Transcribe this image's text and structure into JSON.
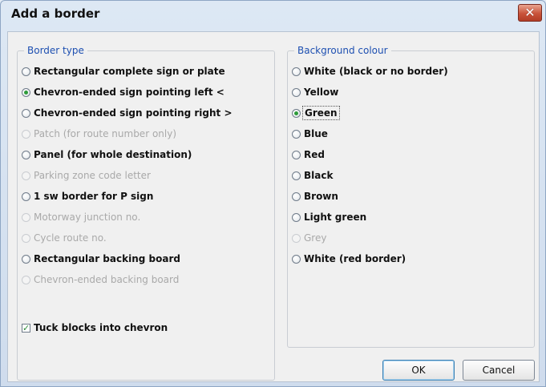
{
  "dialog": {
    "title": "Add a border",
    "close_glyph": "✕"
  },
  "border_type": {
    "legend": "Border type",
    "options": [
      {
        "label": "Rectangular complete sign or plate",
        "checked": false,
        "disabled": false
      },
      {
        "label": "Chevron-ended sign pointing left <",
        "checked": true,
        "disabled": false
      },
      {
        "label": "Chevron-ended sign pointing right >",
        "checked": false,
        "disabled": false
      },
      {
        "label": "Patch (for route number only)",
        "checked": false,
        "disabled": true
      },
      {
        "label": "Panel (for whole destination)",
        "checked": false,
        "disabled": false
      },
      {
        "label": "Parking zone code letter",
        "checked": false,
        "disabled": true
      },
      {
        "label": "1 sw border for P sign",
        "checked": false,
        "disabled": false
      },
      {
        "label": "Motorway junction no.",
        "checked": false,
        "disabled": true
      },
      {
        "label": "Cycle route no.",
        "checked": false,
        "disabled": true
      },
      {
        "label": "Rectangular backing board",
        "checked": false,
        "disabled": false
      },
      {
        "label": "Chevron-ended backing board",
        "checked": false,
        "disabled": true
      }
    ],
    "tuck_label": "Tuck blocks into chevron",
    "tuck_checked": true
  },
  "background_colour": {
    "legend": "Background colour",
    "options": [
      {
        "label": "White (black or no border)",
        "checked": false,
        "disabled": false
      },
      {
        "label": "Yellow",
        "checked": false,
        "disabled": false
      },
      {
        "label": "Green",
        "checked": true,
        "disabled": false
      },
      {
        "label": "Blue",
        "checked": false,
        "disabled": false
      },
      {
        "label": "Red",
        "checked": false,
        "disabled": false
      },
      {
        "label": "Black",
        "checked": false,
        "disabled": false
      },
      {
        "label": "Brown",
        "checked": false,
        "disabled": false
      },
      {
        "label": "Light green",
        "checked": false,
        "disabled": false
      },
      {
        "label": "Grey",
        "checked": false,
        "disabled": true
      },
      {
        "label": "White (red border)",
        "checked": false,
        "disabled": false
      }
    ]
  },
  "buttons": {
    "ok": "OK",
    "cancel": "Cancel"
  },
  "colors": {
    "legend_text": "#1d4fb1",
    "close_button": "#c9533a",
    "radio_check": "#2e9b3a"
  }
}
